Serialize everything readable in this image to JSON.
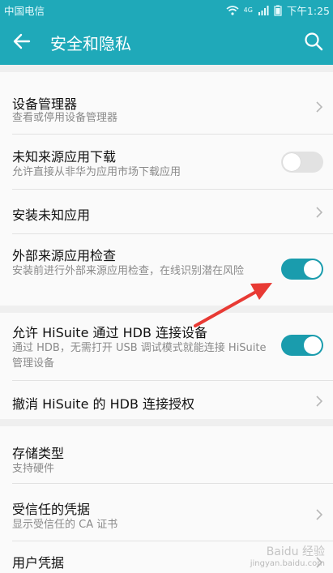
{
  "status_bar": {
    "carrier": "中国电信",
    "network_label": "4G",
    "time": "下午1:25"
  },
  "app_bar": {
    "title": "安全和隐私",
    "back_icon": "arrow-left-icon",
    "search_icon": "search-icon"
  },
  "settings": [
    {
      "title": "设备管理器",
      "subtitle": "查看或停用设备管理器",
      "control": "chevron"
    },
    {
      "title": "未知来源应用下载",
      "subtitle": "允许直接从非华为应用市场下载应用",
      "control": "toggle",
      "on": false
    },
    {
      "title": "安装未知应用",
      "subtitle": "",
      "control": "chevron"
    },
    {
      "title": "外部来源应用检查",
      "subtitle": "安装前进行外部来源应用检查，在线识别潜在风险",
      "control": "toggle",
      "on": true
    },
    {
      "title": "允许 HiSuite 通过 HDB 连接设备",
      "subtitle": "通过 HDB，无需打开 USB 调试模式就能连接 HiSuite 管理设备",
      "control": "toggle",
      "on": true
    },
    {
      "title": "撤消 HiSuite 的 HDB 连接授权",
      "subtitle": "",
      "control": "chevron"
    },
    {
      "title": "存储类型",
      "subtitle": "支持硬件",
      "control": "none"
    },
    {
      "title": "受信任的凭据",
      "subtitle": "显示受信任的 CA 证书",
      "control": "chevron"
    },
    {
      "title": "用户凭据",
      "subtitle": "",
      "control": "chevron"
    }
  ],
  "colors": {
    "accent": "#1fa9b9",
    "toggle_on": "#1a9cad",
    "arrow": "#e83a34"
  },
  "watermark": {
    "line1": "Baidu 经验",
    "line2": "jingyan.baidu.com"
  }
}
